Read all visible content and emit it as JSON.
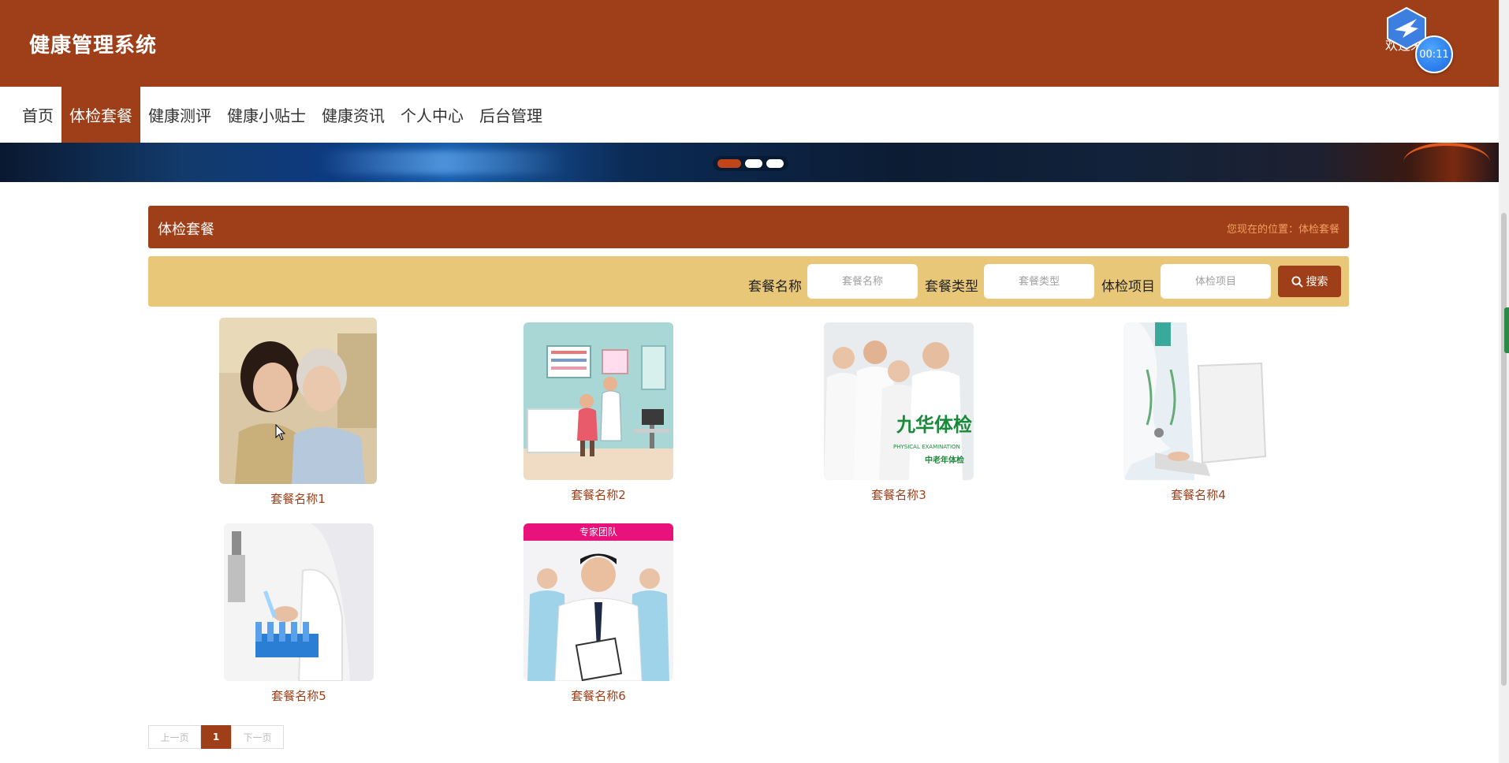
{
  "header": {
    "title": "健康管理系统",
    "welcome": "欢迎来到",
    "timer": "00:11"
  },
  "nav": {
    "items": [
      {
        "label": "首页",
        "active": false
      },
      {
        "label": "体检套餐",
        "active": true
      },
      {
        "label": "健康测评",
        "active": false
      },
      {
        "label": "健康小贴士",
        "active": false
      },
      {
        "label": "健康资讯",
        "active": false
      },
      {
        "label": "个人中心",
        "active": false
      },
      {
        "label": "后台管理",
        "active": false
      }
    ]
  },
  "banner": {
    "slide_count": 3,
    "active_slide": 1
  },
  "section": {
    "title": "体检套餐",
    "location": "您现在的位置：体检套餐"
  },
  "search": {
    "name_label": "套餐名称",
    "name_placeholder": "套餐名称",
    "type_label": "套餐类型",
    "type_placeholder": "套餐类型",
    "item_label": "体检项目",
    "item_placeholder": "体检项目",
    "button_label": "搜索"
  },
  "packages": [
    {
      "name": "套餐名称1"
    },
    {
      "name": "套餐名称2"
    },
    {
      "name": "套餐名称3"
    },
    {
      "name": "套餐名称4",
      "logo": "九华体检"
    },
    {
      "name": "套餐名称5"
    },
    {
      "name": "套餐名称6",
      "tag": "专家团队"
    }
  ],
  "card3_logo": {
    "brand": "九华体检",
    "sub": "PHYSICAL EXAMINATION",
    "sub2": "中老年体检"
  },
  "pagination": {
    "prev": "上一页",
    "current": "1",
    "next": "下一页"
  },
  "colors": {
    "brand": "#9e3f19",
    "search_bg": "#e8c878",
    "location_text": "#f0a060"
  }
}
